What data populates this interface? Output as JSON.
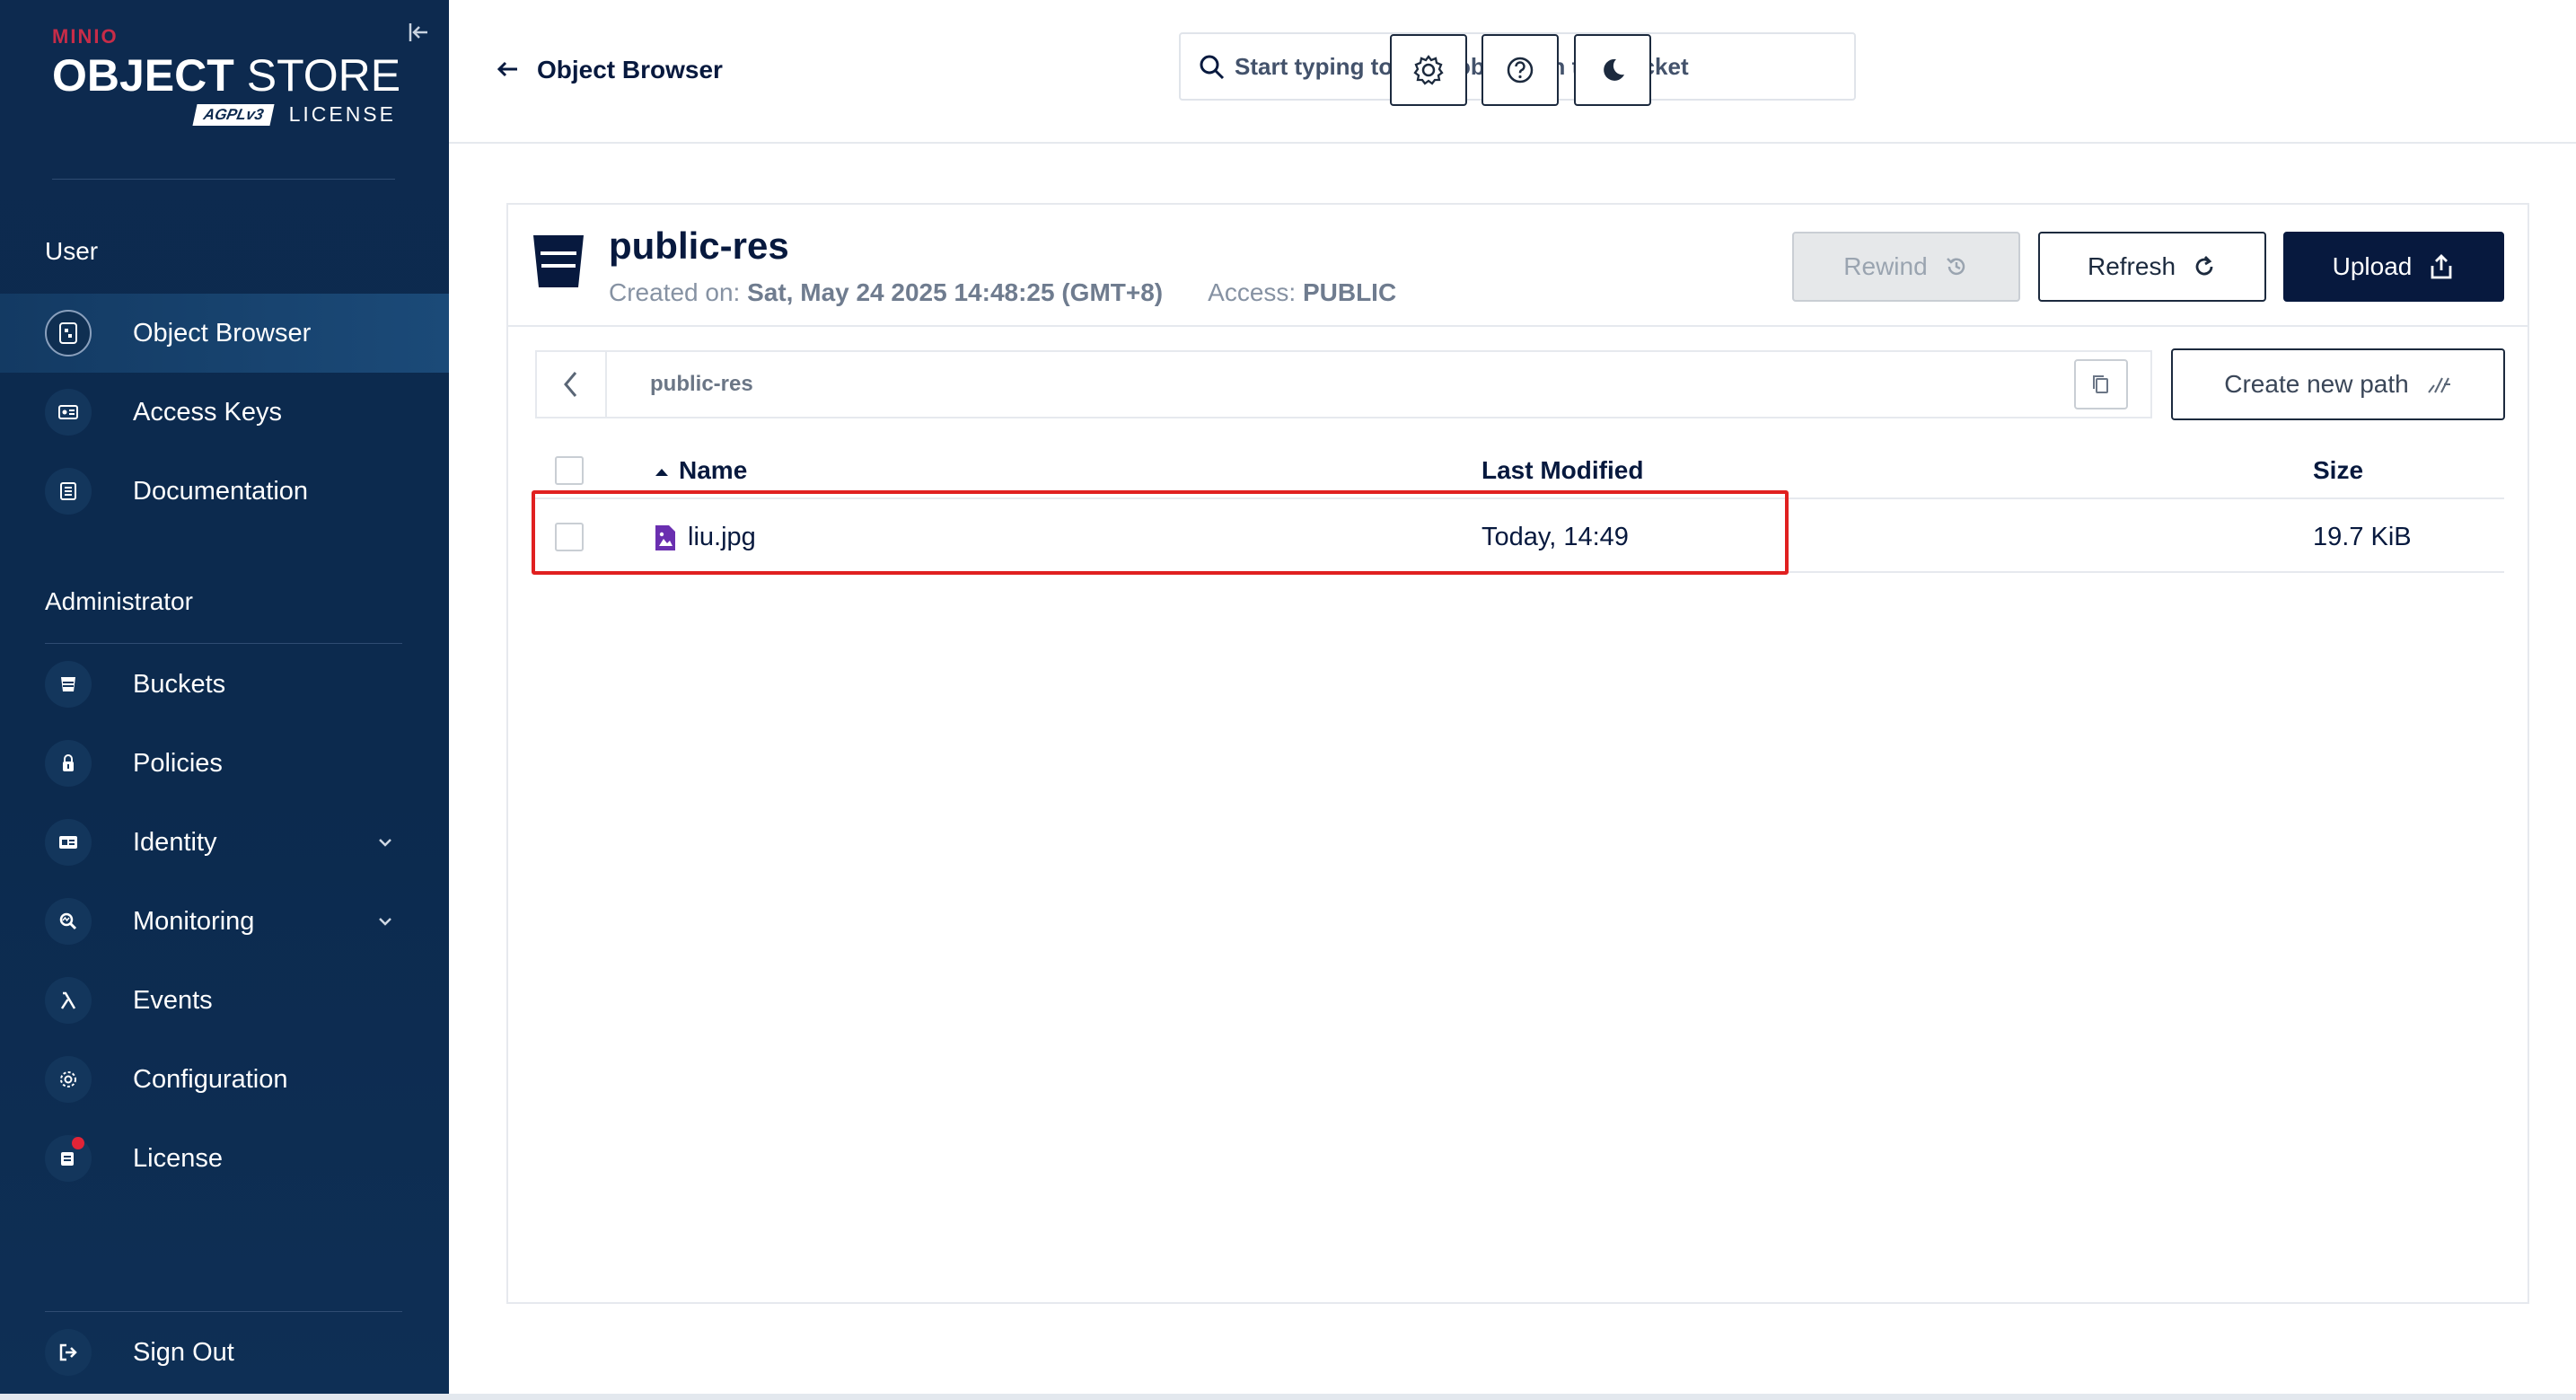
{
  "sidebar": {
    "logo": {
      "brand": "MINIO",
      "product_bold": "OBJECT",
      "product_light": "STORE",
      "agpl": "AGPLv3",
      "license": "LICENSE"
    },
    "user_section": "User",
    "user_items": [
      {
        "label": "Object Browser",
        "icon": "object-browser-icon",
        "active": true
      },
      {
        "label": "Access Keys",
        "icon": "access-keys-icon"
      },
      {
        "label": "Documentation",
        "icon": "documentation-icon"
      }
    ],
    "admin_section": "Administrator",
    "admin_items": [
      {
        "label": "Buckets",
        "icon": "bucket-icon"
      },
      {
        "label": "Policies",
        "icon": "policies-icon"
      },
      {
        "label": "Identity",
        "icon": "identity-icon",
        "expandable": true
      },
      {
        "label": "Monitoring",
        "icon": "monitoring-icon",
        "expandable": true
      },
      {
        "label": "Events",
        "icon": "lambda-icon"
      },
      {
        "label": "Configuration",
        "icon": "gear-icon"
      },
      {
        "label": "License",
        "icon": "license-icon",
        "notification": true
      }
    ],
    "sign_out": "Sign Out"
  },
  "header": {
    "back_label": "Object Browser",
    "search_placeholder": "Start typing to filter objects in the bucket",
    "buttons": [
      "settings-icon",
      "help-icon",
      "dark-mode-icon"
    ]
  },
  "bucket": {
    "name": "public-res",
    "created_label": "Created on:",
    "created_value": "Sat, May 24 2025 14:48:25 (GMT+8)",
    "access_label": "Access:",
    "access_value": "PUBLIC",
    "rewind_label": "Rewind",
    "refresh_label": "Refresh",
    "upload_label": "Upload"
  },
  "path": {
    "current": "public-res",
    "create_new_path_label": "Create new path"
  },
  "table": {
    "columns": [
      "Name",
      "Last Modified",
      "Size"
    ],
    "sort_column": "Name",
    "rows": [
      {
        "name": "liu.jpg",
        "last_modified": "Today, 14:49",
        "size": "19.7 KiB",
        "type": "image"
      }
    ]
  },
  "colors": {
    "sidebar_bg": "#0d2a4f",
    "primary_dark": "#07193e",
    "brand_red": "#c72c48",
    "highlight_red": "#e02020",
    "file_icon_purple": "#6a2fb0"
  }
}
